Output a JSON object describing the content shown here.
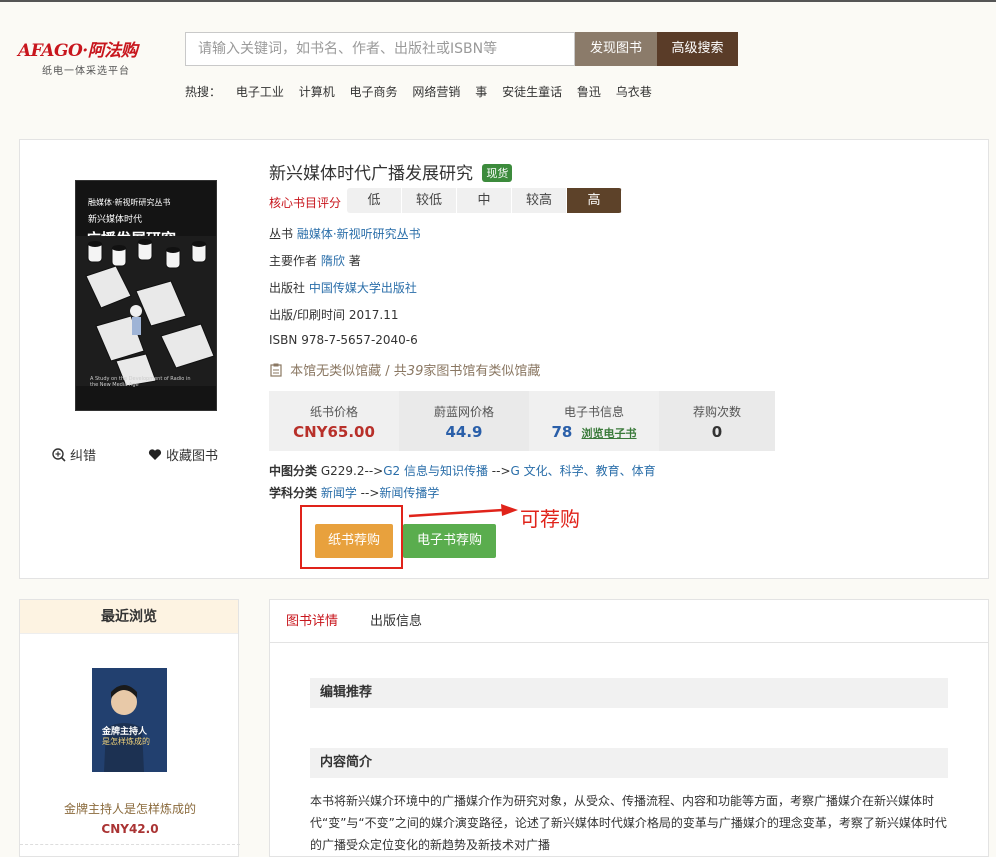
{
  "header": {
    "logo_brand": "AFAGO·阿法购",
    "logo_slogan": "纸电一体采选平台",
    "search_placeholder": "请输入关键词，如书名、作者、出版社或ISBN等",
    "discover_button": "发现图书",
    "advanced_button": "高级搜索",
    "hot_label": "热搜：",
    "hot_terms": [
      "电子工业",
      "计算机",
      "电子商务",
      "网络营销",
      "事",
      "安徒生童话",
      "鲁迅",
      "乌衣巷"
    ]
  },
  "book": {
    "title": "新兴媒体时代广播发展研究",
    "stock_badge": "现货",
    "cover_series_text": "融媒体·新视听研究丛书",
    "cover_title_small": "新兴媒体时代",
    "cover_title_big": "广播发展研究",
    "cover_subtitle": "A Study on the Development of Radio in the New Media Age",
    "core_label": "核心书目评分",
    "rating_levels": [
      "低",
      "较低",
      "中",
      "较高",
      "高"
    ],
    "series_label": "丛书",
    "series_value": "融媒体·新视听研究丛书",
    "author_label": "主要作者",
    "author_value": "隋欣",
    "author_suffix": "著",
    "publisher_label": "出版社",
    "publisher_value": "中国传媒大学出版社",
    "pubdate_label": "出版/印刷时间",
    "pubdate_value": "2017.11",
    "isbn_label": "ISBN",
    "isbn_value": "978-7-5657-2040-6",
    "holding_note_a": "本馆无类似馆藏 / 共",
    "holding_count": "39",
    "holding_note_b": "家图书馆有类似馆藏",
    "correct_label": "纠错",
    "favorite_label": "收藏图书",
    "prices": {
      "paper_label": "纸书价格",
      "paper_value": "CNY65.00",
      "weilan_label": "蔚蓝网价格",
      "weilan_value": "44.9",
      "ebook_label": "电子书信息",
      "ebook_value": "78",
      "ebook_link": "浏览电子书",
      "count_label": "荐购次数",
      "count_value": "0"
    },
    "clc_label": "中图分类",
    "clc_value_a": "G229.2-->",
    "clc_value_b": "G2 信息与知识传播",
    "clc_value_c": " -->",
    "clc_value_d": "G 文化、科学、教育、体育",
    "subject_label": "学科分类",
    "subject_value_a": "新闻学",
    "subject_value_b": " -->",
    "subject_value_c": "新闻传播学",
    "paper_buy_button": "纸书荐购",
    "ebook_buy_button": "电子书荐购",
    "annotation_text": "可荐购"
  },
  "recent": {
    "heading": "最近浏览",
    "cover_text_a": "金牌主持人",
    "cover_text_b": "是怎样炼成的",
    "title": "金牌主持人是怎样炼成的",
    "price": "CNY42.0"
  },
  "detail": {
    "tabs": [
      "图书详情",
      "出版信息"
    ],
    "editor_section": "编辑推荐",
    "content_section": "内容简介",
    "intro_text": "本书将新兴媒介环境中的广播媒介作为研究对象，从受众、传播流程、内容和功能等方面，考察广播媒介在新兴媒体时代“变”与“不变”之间的媒介演变路径，论述了新兴媒体时代媒介格局的变革与广播媒介的理念变革，考察了新兴媒体时代的广播受众定位变化的新趋势及新技术对广播"
  },
  "colors": {
    "brand_red": "#c8161d",
    "rating_active": "#5d4229",
    "paper_price": "#b8302a",
    "weilan_price": "#2a5fa9",
    "paper_buy": "#e8a13d",
    "ebook_buy": "#5aad4e",
    "annotation": "#e0231a"
  }
}
